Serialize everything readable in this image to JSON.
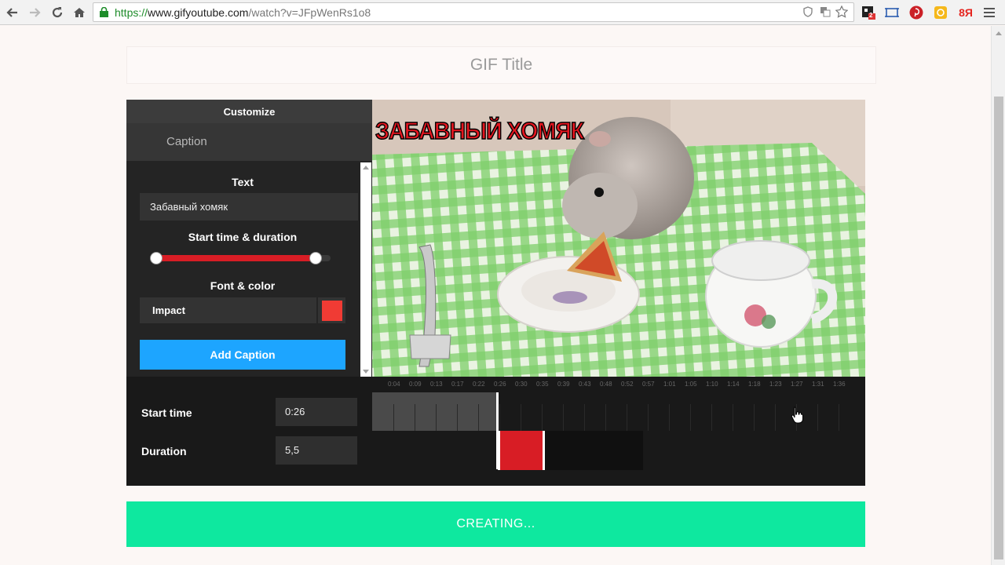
{
  "browser": {
    "url_scheme": "https://",
    "url_host": "www.gifyoutube.com",
    "url_path": "/watch?v=JFpWenRs1o8",
    "ext_badge": "2",
    "ext_ya": "Я"
  },
  "title_input": {
    "placeholder": "GIF Title"
  },
  "customize": {
    "header": "Customize",
    "tab": "Caption",
    "text_label": "Text",
    "text_value": "Забавный хомяк",
    "timing_label": "Start time & duration",
    "timing_range": {
      "start": 0.0,
      "end": 0.95
    },
    "font_label": "Font & color",
    "font_value": "Impact",
    "color": "#f03b34",
    "add_button": "Add Caption"
  },
  "video": {
    "caption_overlay": "ЗАБАВНЫЙ ХОМЯК"
  },
  "timeline": {
    "ticks": [
      "0:04",
      "0:09",
      "0:13",
      "0:17",
      "0:22",
      "0:26",
      "0:30",
      "0:35",
      "0:39",
      "0:43",
      "0:48",
      "0:52",
      "0:57",
      "1:01",
      "1:05",
      "1:10",
      "1:14",
      "1:18",
      "1:23",
      "1:27",
      "1:31",
      "1:36"
    ],
    "start_label": "Start time",
    "start_value": "0:26",
    "duration_label": "Duration",
    "duration_value": "5,5"
  },
  "create_button": "CREATING..."
}
